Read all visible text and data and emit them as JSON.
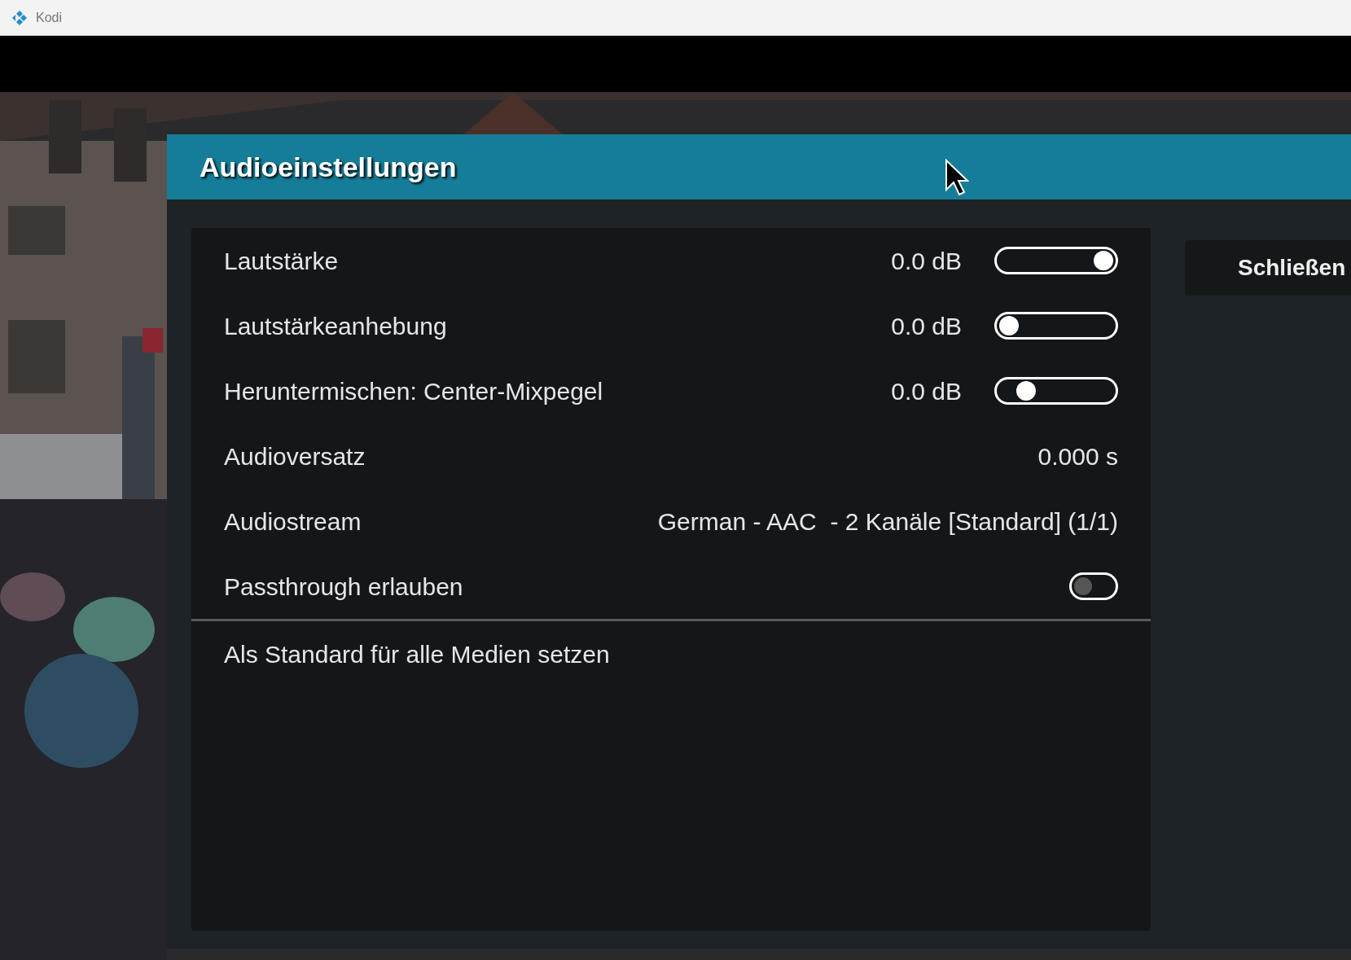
{
  "window": {
    "title": "Kodi"
  },
  "dialog": {
    "title": "Audioeinstellungen",
    "settings": [
      {
        "kind": "slider",
        "label": "Lautstärke",
        "value": "0.0 dB",
        "level": 1
      },
      {
        "kind": "slider",
        "label": "Lautstärkeanhebung",
        "value": "0.0 dB",
        "level": 0
      },
      {
        "kind": "slider",
        "label": "Heruntermischen: Center-Mixpegel",
        "value": "0.0 dB",
        "level": 0.18
      },
      {
        "kind": "value",
        "label": "Audioversatz",
        "value": "0.000 s"
      },
      {
        "kind": "value",
        "label": "Audiostream",
        "value": "German - AAC  - 2 Kanäle [Standard] (1/1)"
      },
      {
        "kind": "toggle",
        "label": "Passthrough erlauben",
        "on": false
      }
    ],
    "actions": [
      {
        "label": "Als Standard für alle Medien setzen"
      }
    ],
    "buttons": [
      {
        "label": "Schließen"
      }
    ]
  }
}
